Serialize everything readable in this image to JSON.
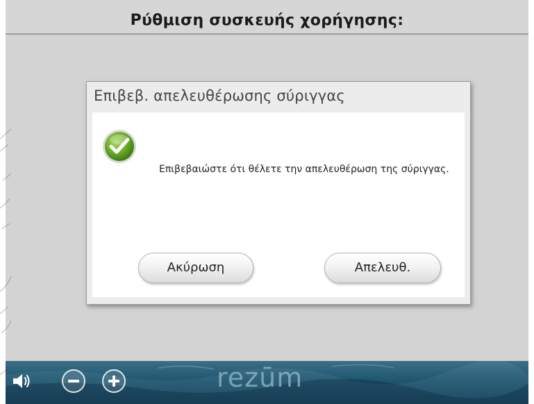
{
  "header": {
    "title": "Ρύθμιση συσκευής χορήγησης:"
  },
  "dialog": {
    "title": "Επιβεβ. απελευθέρωσης σύριγγας",
    "message": "Επιβεβαιώστε ότι θέλετε την απελευθέρωση της σύριγγας.",
    "icon": "check-circle-icon",
    "cancel_label": "Ακύρωση",
    "release_label": "Απελευθ."
  },
  "footer": {
    "logo_text": "rezūm",
    "icons": [
      "speaker-icon",
      "volume-down-icon",
      "volume-up-icon"
    ]
  },
  "colors": {
    "screen_bg": "#d3d3d3",
    "dialog_frame": "#ececec",
    "check_green": "#6fae2b",
    "footer_blue": "#1f5670"
  }
}
